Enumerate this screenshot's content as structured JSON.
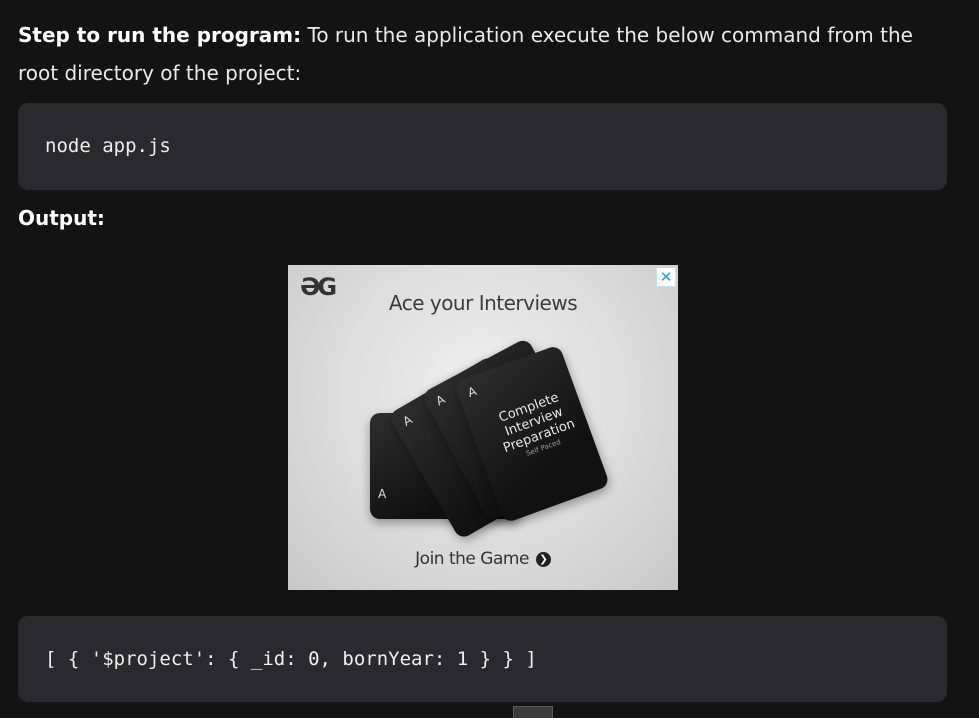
{
  "step": {
    "bold_label": "Step to run the program:",
    "text": " To run the application execute the below command from the root directory of the project:"
  },
  "code_command": "node app.js",
  "output_label": "Output:",
  "ad": {
    "logo": "ƏG",
    "close_glyph": "✕",
    "title": "Ace your Interviews",
    "card_title_line1": "Complete",
    "card_title_line2": "Interview",
    "card_title_line3": "Preparation",
    "card_subtitle": "Self Paced",
    "card_letter": "A",
    "cta_label": "Join the Game",
    "cta_arrow": "❯"
  },
  "code_output": "[ { '$project': { _id: 0, bornYear: 1 } } ]"
}
